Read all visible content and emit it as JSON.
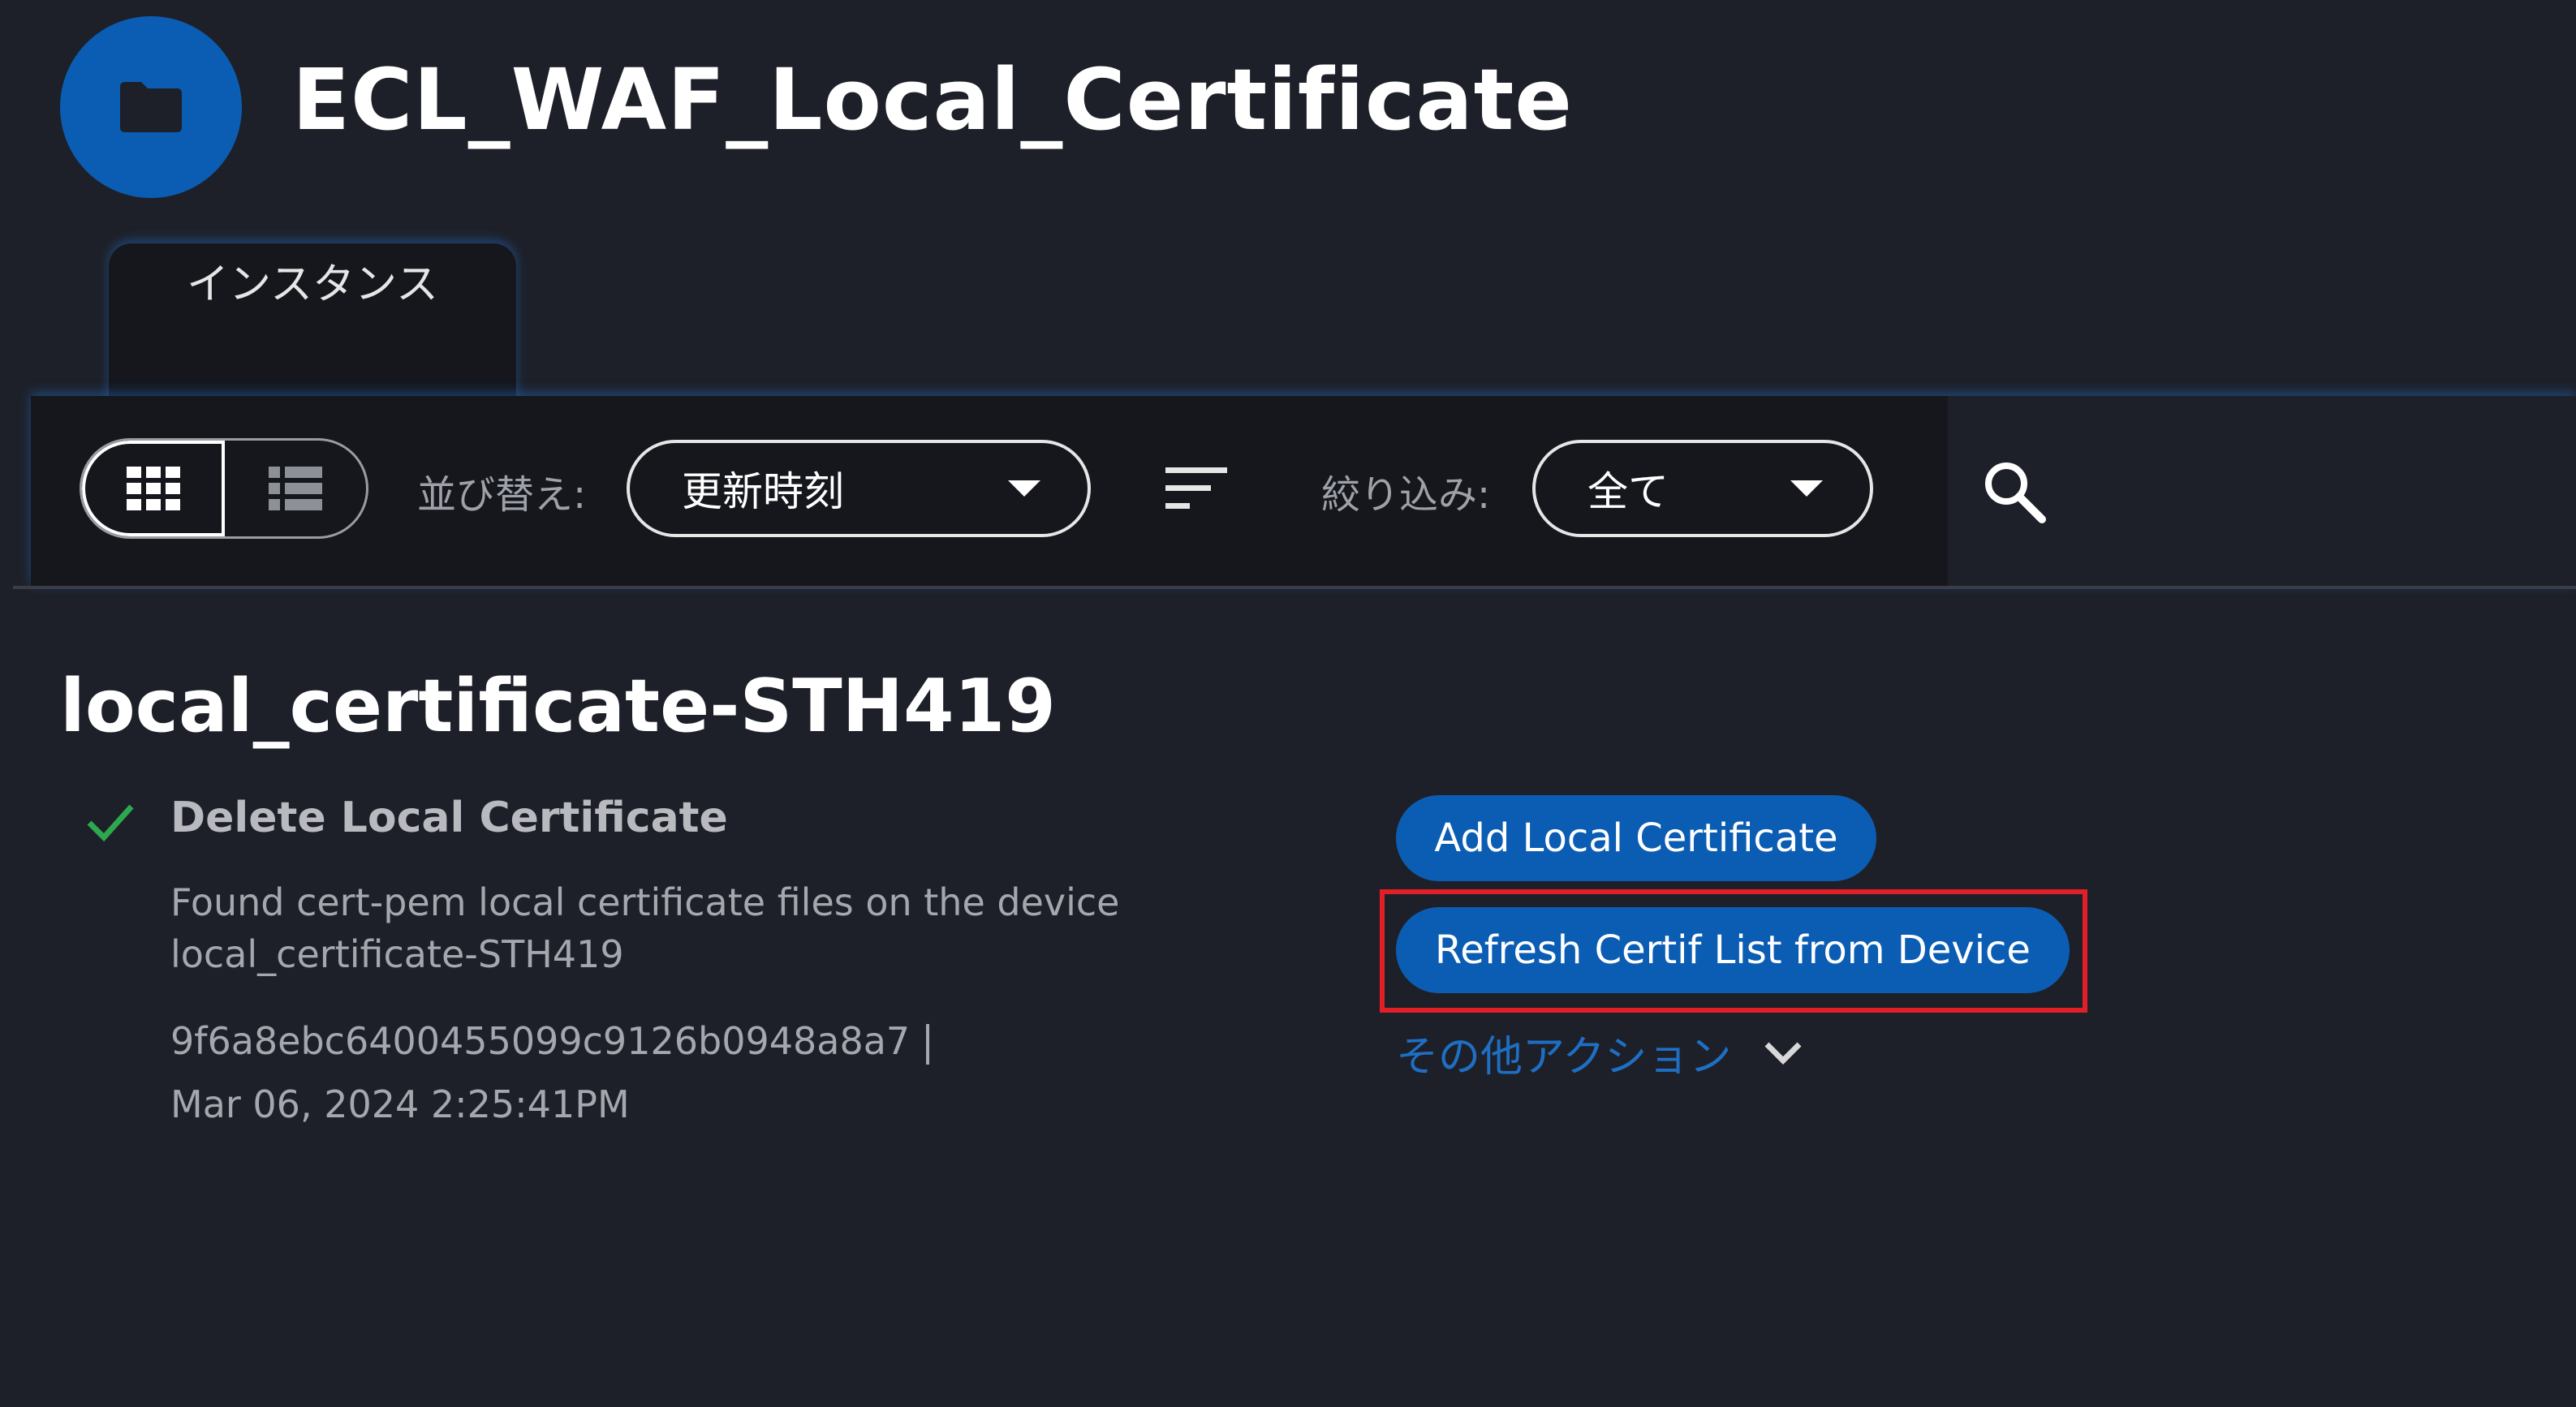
{
  "header": {
    "title": "ECL_WAF_Local_Certificate",
    "icon": "folder-icon"
  },
  "tabs": [
    {
      "label": "インスタンス",
      "active": true
    }
  ],
  "toolbar": {
    "view_modes": [
      "grid-view-icon",
      "list-view-icon"
    ],
    "active_view": "grid",
    "sort_label": "並び替え:",
    "sort_value": "更新時刻",
    "filter_label": "絞り込み:",
    "filter_value": "全て",
    "search_icon": "search-icon"
  },
  "instance": {
    "title": "local_certificate-STH419",
    "status": {
      "icon": "check-icon",
      "color": "#2ea84f",
      "title": "Delete Local Certificate",
      "description": "Found cert-pem local certificate files on the device local_certificate-STH419",
      "id": "9f6a8ebc6400455099c9126b0948a8a7",
      "timestamp": "Mar 06, 2024 2:25:41PM"
    },
    "actions": {
      "add": "Add Local Certificate",
      "refresh": "Refresh Certif List from Device",
      "more": "その他アクション"
    }
  },
  "colors": {
    "accent": "#0b5db3",
    "highlight": "#e21f26",
    "link": "#1e6fc4",
    "background": "#1d2028"
  }
}
